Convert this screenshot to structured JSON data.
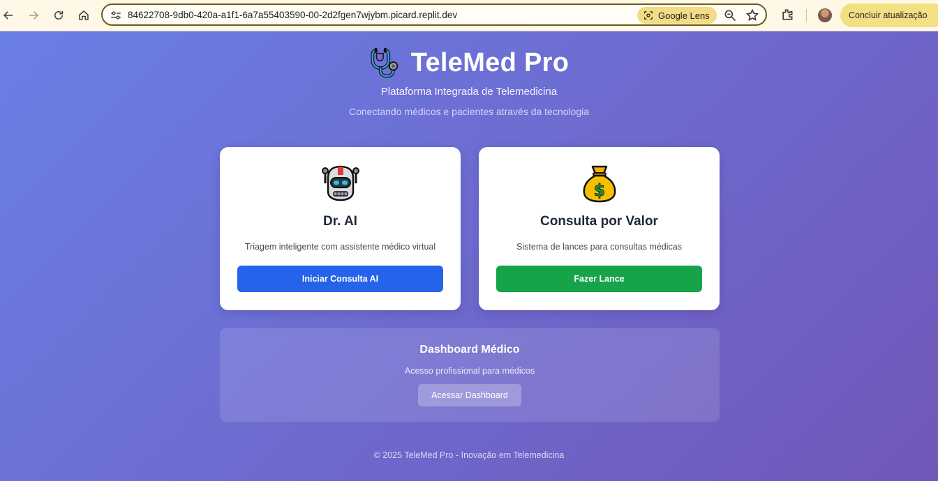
{
  "browser": {
    "url": "84622708-9db0-420a-a1f1-6a7a55403590-00-2d2fgen7wjybm.picard.replit.dev",
    "lens_label": "Google Lens",
    "update_label": "Concluir atualização"
  },
  "header": {
    "title": "TeleMed Pro",
    "subtitle": "Plataforma Integrada de Telemedicina",
    "tagline": "Conectando médicos e pacientes através da tecnologia"
  },
  "cards": [
    {
      "icon": "robot-icon",
      "title": "Dr. AI",
      "description": "Triagem inteligente com assistente médico virtual",
      "button": "Iniciar Consulta AI",
      "button_color": "#2563eb"
    },
    {
      "icon": "money-bag-icon",
      "title": "Consulta por Valor",
      "description": "Sistema de lances para consultas médicas",
      "button": "Fazer Lance",
      "button_color": "#16a34a"
    }
  ],
  "dashboard": {
    "title": "Dashboard Médico",
    "description": "Acesso profissional para médicos",
    "button": "Acessar Dashboard"
  },
  "footer": "© 2025 TeleMed Pro - Inovação em Telemedicina",
  "colors": {
    "gradient_start": "#6a7fe6",
    "gradient_end": "#7157b8"
  }
}
